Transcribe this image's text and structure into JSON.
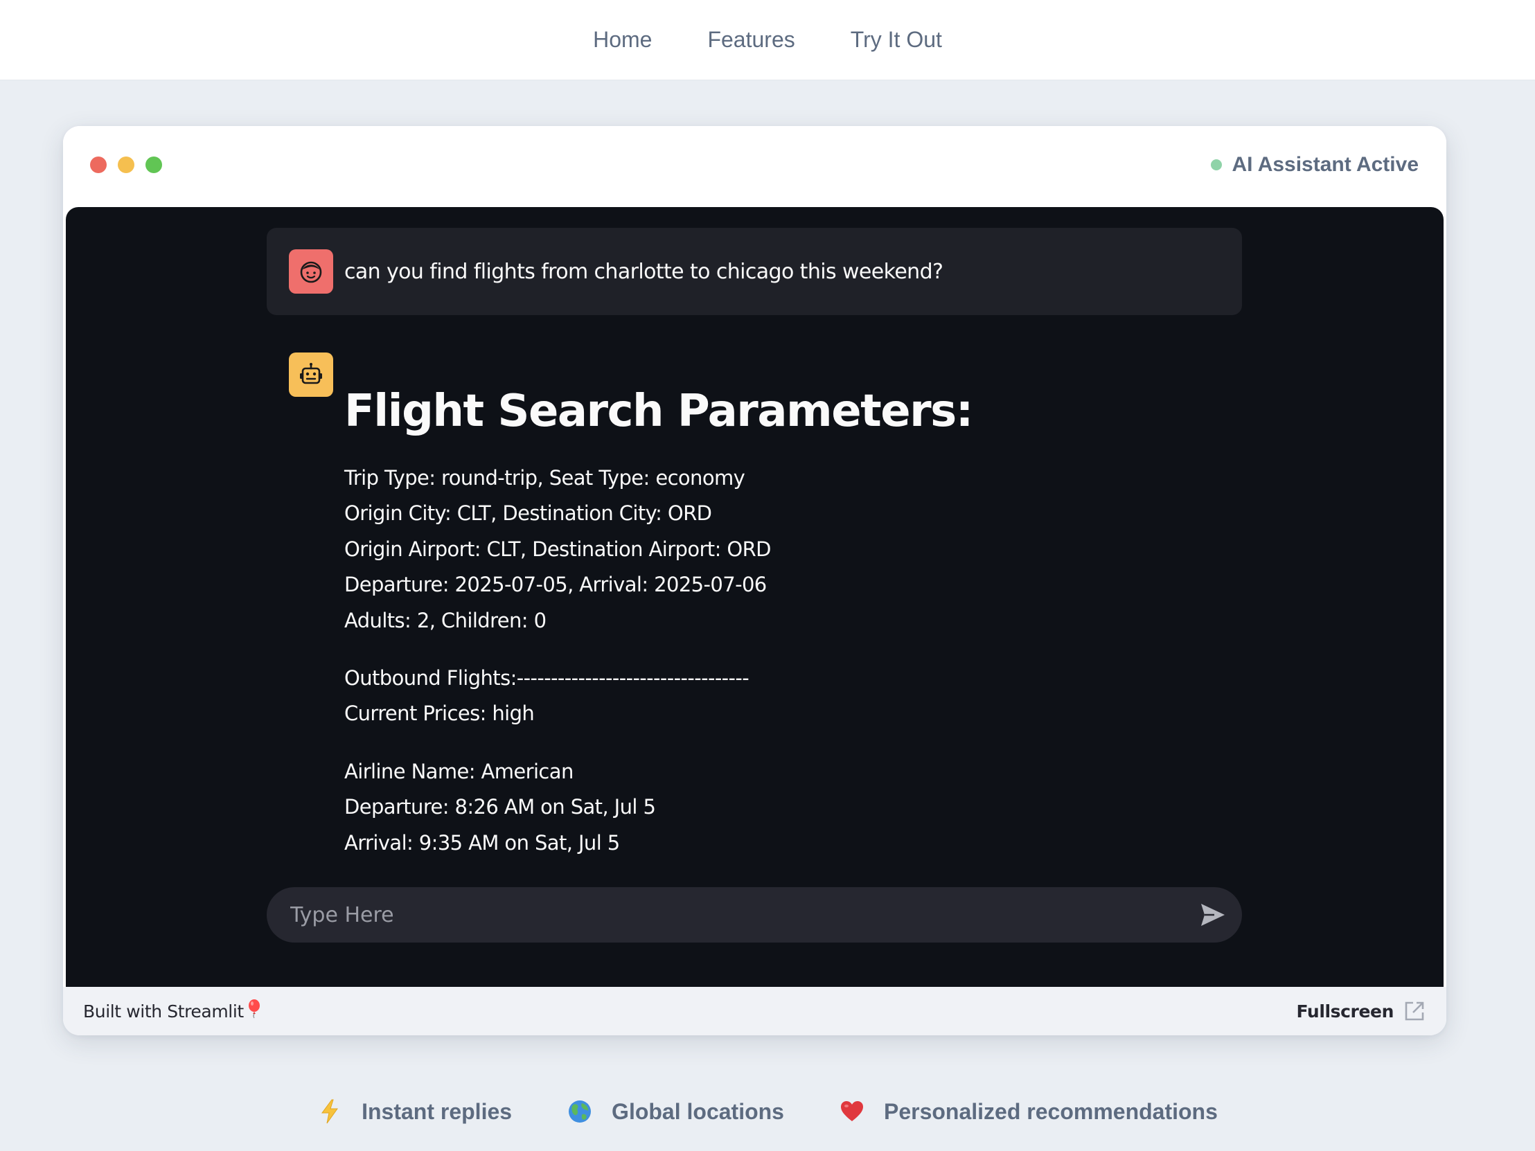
{
  "nav": {
    "items": [
      {
        "label": "Home"
      },
      {
        "label": "Features"
      },
      {
        "label": "Try It Out"
      }
    ]
  },
  "window": {
    "status_text": "AI Assistant Active",
    "status_color": "#8fd3a8"
  },
  "chat": {
    "user_message": "can you find flights from charlotte to chicago this weekend?",
    "user_avatar_icon": "face-icon",
    "bot_avatar_icon": "robot-icon",
    "bot_heading": "Flight Search Parameters:",
    "params": [
      "Trip Type: round-trip, Seat Type: economy",
      "Origin City: CLT, Destination City: ORD",
      "Origin Airport: CLT, Destination Airport: ORD",
      "Departure: 2025-07-05, Arrival: 2025-07-06",
      "Adults: 2, Children: 0"
    ],
    "outbound": [
      "Outbound Flights:----------------------------------",
      "Current Prices: high"
    ],
    "flight": [
      "Airline Name: American",
      "Departure: 8:26 AM on Sat, Jul 5",
      "Arrival: 9:35 AM on Sat, Jul 5"
    ],
    "input_placeholder": "Type Here",
    "input_value": ""
  },
  "footer": {
    "built_with": "Built with Streamlit",
    "fullscreen_label": "Fullscreen"
  },
  "features": [
    {
      "label": "Instant replies",
      "icon": "lightning-icon"
    },
    {
      "label": "Global locations",
      "icon": "globe-icon"
    },
    {
      "label": "Personalized recommendations",
      "icon": "heart-icon"
    }
  ],
  "colors": {
    "page_bg": "#eaeef3",
    "frame_bg": "#0e1117",
    "user_avatar": "#ef6f6c",
    "bot_avatar": "#f7bf59",
    "muted_text": "#5d6b80"
  }
}
